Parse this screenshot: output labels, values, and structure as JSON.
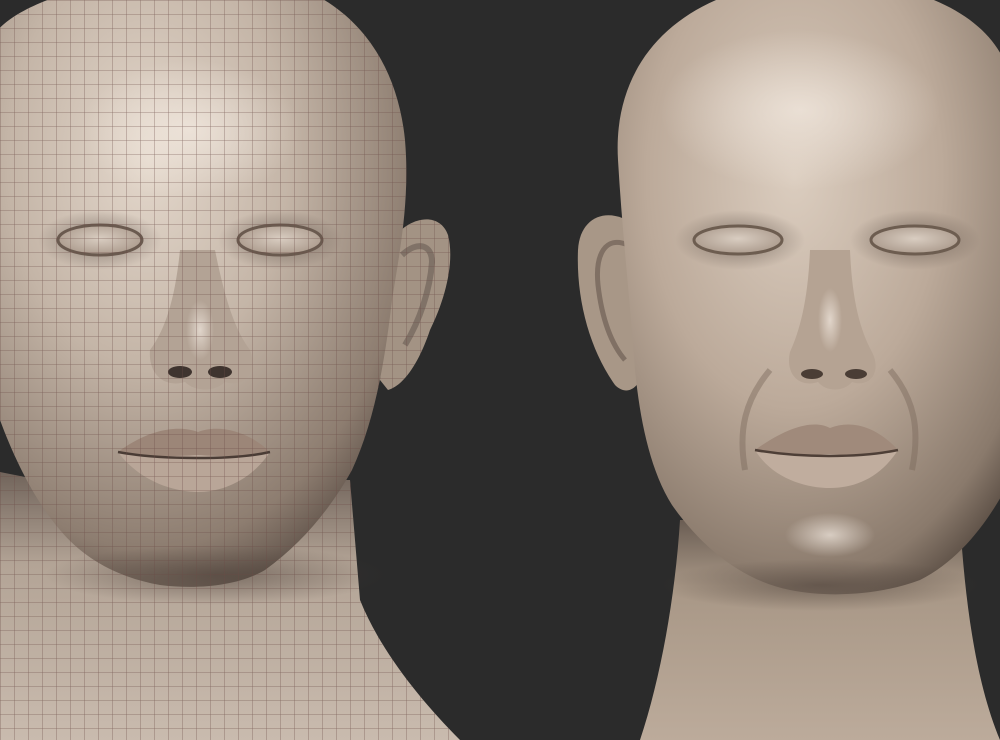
{
  "scene": {
    "background_color": "#2b2b2b",
    "skin_base_color": "#b9aa9c",
    "skin_light_color": "#e2d6ca",
    "skin_shadow_color": "#5e5149",
    "wire_color": "#6b4a45",
    "panels": [
      {
        "name": "wireframe-head",
        "display_mode": "shaded-with-polyframe"
      },
      {
        "name": "sculpted-head",
        "display_mode": "shaded"
      }
    ]
  }
}
